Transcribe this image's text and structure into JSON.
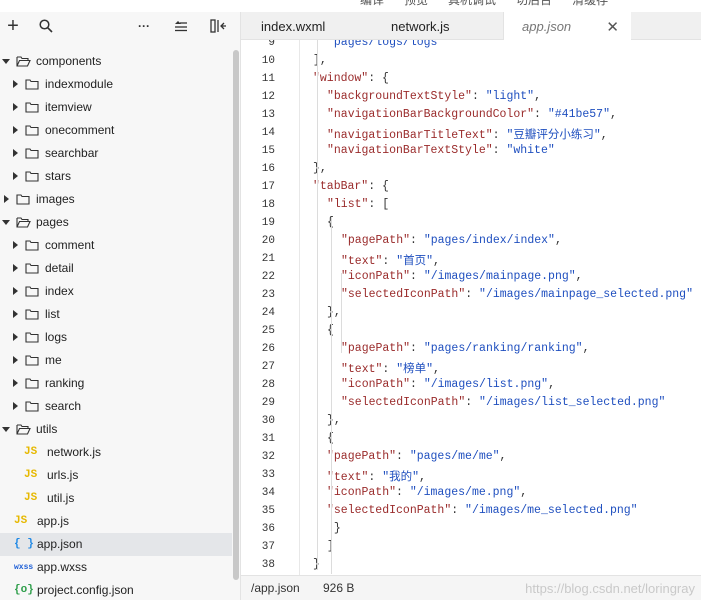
{
  "top_menu": [
    "编译",
    "预览",
    "真机调试",
    "切后台",
    "清缓存"
  ],
  "toolbar": {
    "icons": [
      "plus-icon",
      "search-icon",
      "more-icon",
      "collapse-icon",
      "split-icon"
    ],
    "plus": "+",
    "more": "···"
  },
  "tree": [
    {
      "type": "folder",
      "open": true,
      "depth": 0,
      "label": "components"
    },
    {
      "type": "folder",
      "open": false,
      "depth": 1,
      "label": "indexmodule"
    },
    {
      "type": "folder",
      "open": false,
      "depth": 1,
      "label": "itemview"
    },
    {
      "type": "folder",
      "open": false,
      "depth": 1,
      "label": "onecomment"
    },
    {
      "type": "folder",
      "open": false,
      "depth": 1,
      "label": "searchbar"
    },
    {
      "type": "folder",
      "open": false,
      "depth": 1,
      "label": "stars"
    },
    {
      "type": "folder",
      "open": false,
      "depth": 0,
      "label": "images"
    },
    {
      "type": "folder",
      "open": true,
      "depth": 0,
      "label": "pages"
    },
    {
      "type": "folder",
      "open": false,
      "depth": 1,
      "label": "comment"
    },
    {
      "type": "folder",
      "open": false,
      "depth": 1,
      "label": "detail"
    },
    {
      "type": "folder",
      "open": false,
      "depth": 1,
      "label": "index"
    },
    {
      "type": "folder",
      "open": false,
      "depth": 1,
      "label": "list"
    },
    {
      "type": "folder",
      "open": false,
      "depth": 1,
      "label": "logs"
    },
    {
      "type": "folder",
      "open": false,
      "depth": 1,
      "label": "me"
    },
    {
      "type": "folder",
      "open": false,
      "depth": 1,
      "label": "ranking"
    },
    {
      "type": "folder",
      "open": false,
      "depth": 1,
      "label": "search"
    },
    {
      "type": "folder",
      "open": true,
      "depth": 0,
      "label": "utils"
    },
    {
      "type": "file",
      "icon": "JS",
      "kind": "js",
      "depth": 1,
      "label": "network.js"
    },
    {
      "type": "file",
      "icon": "JS",
      "kind": "js",
      "depth": 1,
      "label": "urls.js"
    },
    {
      "type": "file",
      "icon": "JS",
      "kind": "js",
      "depth": 1,
      "label": "util.js"
    },
    {
      "type": "file",
      "icon": "JS",
      "kind": "js",
      "depth": 0,
      "label": "app.js"
    },
    {
      "type": "file",
      "icon": "{ }",
      "kind": "json",
      "depth": 0,
      "label": "app.json",
      "selected": true
    },
    {
      "type": "file",
      "icon": "wxss",
      "kind": "wxss",
      "depth": 0,
      "label": "app.wxss"
    },
    {
      "type": "file",
      "icon": "{o}",
      "kind": "cfg",
      "depth": 0,
      "label": "project.config.json"
    }
  ],
  "tabs": [
    {
      "label": "index.wxml",
      "active": false
    },
    {
      "label": "network.js",
      "active": false
    },
    {
      "label": "app.json",
      "active": true,
      "close": "✕"
    }
  ],
  "code_lines": [
    {
      "n": "9",
      "indent": 2,
      "t": [
        [
          "s",
          "\"pages/logs/logs\""
        ]
      ]
    },
    {
      "n": "10",
      "indent": 1,
      "t": [
        [
          "p",
          "],"
        ]
      ]
    },
    {
      "n": "11",
      "indent": 1,
      "t": [
        [
          "k",
          "\"window\""
        ],
        [
          "p",
          ": {"
        ]
      ]
    },
    {
      "n": "12",
      "indent": 2,
      "t": [
        [
          "k",
          "\"backgroundTextStyle\""
        ],
        [
          "p",
          ": "
        ],
        [
          "s",
          "\"light\""
        ],
        [
          "p",
          ","
        ]
      ]
    },
    {
      "n": "13",
      "indent": 2,
      "t": [
        [
          "k",
          "\"navigationBarBackgroundColor\""
        ],
        [
          "p",
          ": "
        ],
        [
          "s",
          "\"#41be57\""
        ],
        [
          "p",
          ","
        ]
      ]
    },
    {
      "n": "14",
      "indent": 2,
      "t": [
        [
          "k",
          "\"navigationBarTitleText\""
        ],
        [
          "p",
          ": "
        ],
        [
          "s",
          "\"豆瓣评分小练习\""
        ],
        [
          "p",
          ","
        ]
      ]
    },
    {
      "n": "15",
      "indent": 2,
      "t": [
        [
          "k",
          "\"navigationBarTextStyle\""
        ],
        [
          "p",
          ": "
        ],
        [
          "s",
          "\"white\""
        ]
      ]
    },
    {
      "n": "16",
      "indent": 1,
      "t": [
        [
          "p",
          "},"
        ]
      ]
    },
    {
      "n": "17",
      "indent": 1,
      "t": [
        [
          "k",
          "\"tabBar\""
        ],
        [
          "p",
          ": {"
        ]
      ]
    },
    {
      "n": "18",
      "indent": 2,
      "t": [
        [
          "k",
          "\"list\""
        ],
        [
          "p",
          ": ["
        ]
      ]
    },
    {
      "n": "19",
      "indent": 2,
      "t": [
        [
          "p",
          "{"
        ]
      ]
    },
    {
      "n": "20",
      "indent": 3,
      "t": [
        [
          "k",
          "\"pagePath\""
        ],
        [
          "p",
          ": "
        ],
        [
          "s",
          "\"pages/index/index\""
        ],
        [
          "p",
          ","
        ]
      ]
    },
    {
      "n": "21",
      "indent": 3,
      "t": [
        [
          "k",
          "\"text\""
        ],
        [
          "p",
          ": "
        ],
        [
          "s",
          "\"首页\""
        ],
        [
          "p",
          ","
        ]
      ]
    },
    {
      "n": "22",
      "indent": 3,
      "t": [
        [
          "k",
          "\"iconPath\""
        ],
        [
          "p",
          ": "
        ],
        [
          "s",
          "\"/images/mainpage.png\""
        ],
        [
          "p",
          ","
        ]
      ]
    },
    {
      "n": "23",
      "indent": 3,
      "t": [
        [
          "k",
          "\"selectedIconPath\""
        ],
        [
          "p",
          ": "
        ],
        [
          "s",
          "\"/images/mainpage_selected.png\""
        ]
      ]
    },
    {
      "n": "24",
      "indent": 2,
      "t": [
        [
          "p",
          "},"
        ]
      ]
    },
    {
      "n": "25",
      "indent": 2,
      "t": [
        [
          "p",
          "{"
        ]
      ]
    },
    {
      "n": "26",
      "indent": 3,
      "t": [
        [
          "k",
          "\"pagePath\""
        ],
        [
          "p",
          ": "
        ],
        [
          "s",
          "\"pages/ranking/ranking\""
        ],
        [
          "p",
          ","
        ]
      ]
    },
    {
      "n": "27",
      "indent": 3,
      "t": [
        [
          "k",
          "\"text\""
        ],
        [
          "p",
          ": "
        ],
        [
          "s",
          "\"榜单\""
        ],
        [
          "p",
          ","
        ]
      ]
    },
    {
      "n": "28",
      "indent": 3,
      "t": [
        [
          "k",
          "\"iconPath\""
        ],
        [
          "p",
          ": "
        ],
        [
          "s",
          "\"/images/list.png\""
        ],
        [
          "p",
          ","
        ]
      ]
    },
    {
      "n": "29",
      "indent": 3,
      "t": [
        [
          "k",
          "\"selectedIconPath\""
        ],
        [
          "p",
          ": "
        ],
        [
          "s",
          "\"/images/list_selected.png\""
        ]
      ]
    },
    {
      "n": "30",
      "indent": 2,
      "t": [
        [
          "p",
          "},"
        ]
      ]
    },
    {
      "n": "31",
      "indent": 2,
      "t": [
        [
          "p",
          "{"
        ]
      ]
    },
    {
      "n": "32",
      "indent": 2,
      "t": [
        [
          "k",
          "\"pagePath\""
        ],
        [
          "p",
          ": "
        ],
        [
          "s",
          "\"pages/me/me\""
        ],
        [
          "p",
          ","
        ]
      ]
    },
    {
      "n": "33",
      "indent": 2,
      "t": [
        [
          "k",
          "\"text\""
        ],
        [
          "p",
          ": "
        ],
        [
          "s",
          "\"我的\""
        ],
        [
          "p",
          ","
        ]
      ]
    },
    {
      "n": "34",
      "indent": 2,
      "t": [
        [
          "k",
          "\"iconPath\""
        ],
        [
          "p",
          ": "
        ],
        [
          "s",
          "\"/images/me.png\""
        ],
        [
          "p",
          ","
        ]
      ]
    },
    {
      "n": "35",
      "indent": 2,
      "t": [
        [
          "k",
          "\"selectedIconPath\""
        ],
        [
          "p",
          ": "
        ],
        [
          "s",
          "\"/images/me_selected.png\""
        ]
      ]
    },
    {
      "n": "36",
      "indent": 2,
      "t": [
        [
          "p",
          " }"
        ]
      ]
    },
    {
      "n": "37",
      "indent": 2,
      "t": [
        [
          "p",
          "]"
        ]
      ]
    },
    {
      "n": "38",
      "indent": 1,
      "t": [
        [
          "p",
          "}"
        ]
      ]
    }
  ],
  "status": {
    "path": "/app.json",
    "size": "926 B"
  },
  "watermark": "https://blog.csdn.net/loringray",
  "colors": {
    "key": "#9a2b2b",
    "string": "#1f4fbf",
    "folder_stroke": "#333333"
  }
}
